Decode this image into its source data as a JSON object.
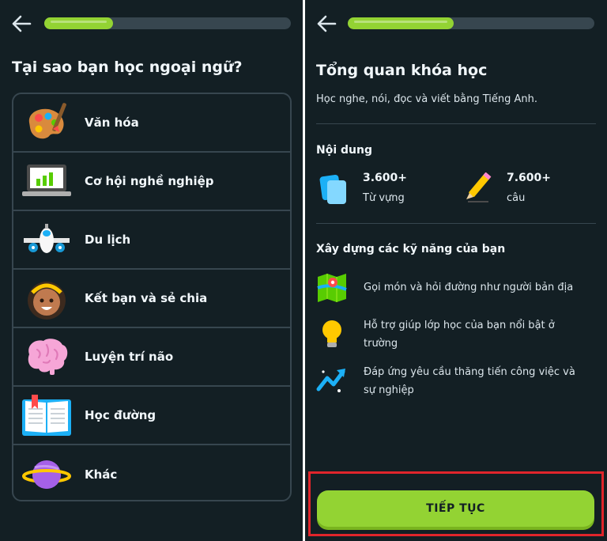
{
  "left": {
    "progress": 0.28,
    "title": "Tại sao bạn học ngoại ngữ?",
    "options": [
      {
        "label": "Văn hóa",
        "icon": "palette-icon"
      },
      {
        "label": "Cơ hội nghề nghiệp",
        "icon": "laptop-chart-icon"
      },
      {
        "label": "Du lịch",
        "icon": "airplane-icon"
      },
      {
        "label": "Kết bạn và sẻ chia",
        "icon": "friend-avatar-icon"
      },
      {
        "label": "Luyện trí não",
        "icon": "brain-icon"
      },
      {
        "label": "Học đường",
        "icon": "book-icon"
      },
      {
        "label": "Khác",
        "icon": "planet-icon"
      }
    ]
  },
  "right": {
    "progress": 0.43,
    "title": "Tổng quan khóa học",
    "subtitle": "Học nghe, nói, đọc và viết bằng Tiếng Anh.",
    "content_heading": "Nội dung",
    "stats": [
      {
        "value": "3.600+",
        "label": "Từ vựng",
        "icon": "cards-icon"
      },
      {
        "value": "7.600+",
        "label": "câu",
        "icon": "pencil-icon"
      }
    ],
    "skills_heading": "Xây dựng các kỹ năng của bạn",
    "skills": [
      {
        "line1": "Gọi món và hỏi đường như người bản địa",
        "line2": "",
        "icon": "map-icon"
      },
      {
        "line1": "Hỗ trợ giúp lớp học của bạn nổi bật ở",
        "line2": "trường",
        "icon": "lightbulb-icon"
      },
      {
        "line1": "Đáp ứng yêu cầu thăng tiến công việc và",
        "line2": "sự nghiệp",
        "icon": "trending-up-icon"
      }
    ],
    "cta_label": "TIẾP TỤC"
  },
  "colors": {
    "background": "#131f24",
    "accent": "#93d333",
    "border": "#37464f",
    "highlight": "#e0252b"
  }
}
